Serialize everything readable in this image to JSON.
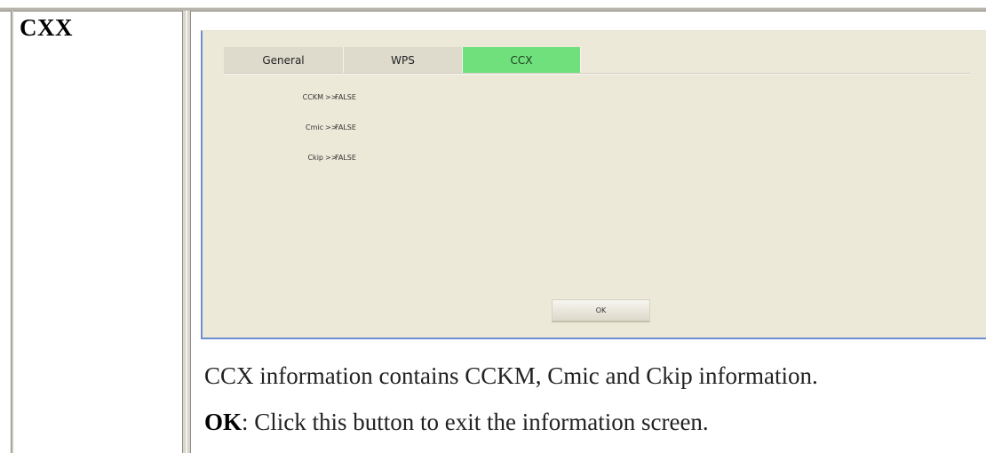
{
  "section": {
    "title": "CXX"
  },
  "dialog": {
    "tabs": [
      {
        "label": "General",
        "active": false
      },
      {
        "label": "WPS",
        "active": false
      },
      {
        "label": "CCX",
        "active": true
      }
    ],
    "active_tab_color": "#6fe07c",
    "rows": [
      {
        "label": "CCKM",
        "separator": ">>",
        "value": "FALSE"
      },
      {
        "label": "Cmic",
        "separator": ">>",
        "value": "FALSE"
      },
      {
        "label": "Ckip",
        "separator": ">>",
        "value": "FALSE"
      }
    ],
    "ok_label": "OK"
  },
  "description": {
    "line1": "CCX information contains CCKM, Cmic and Ckip information.",
    "ok_term": "OK",
    "ok_text": ": Click this button to exit the information screen."
  }
}
